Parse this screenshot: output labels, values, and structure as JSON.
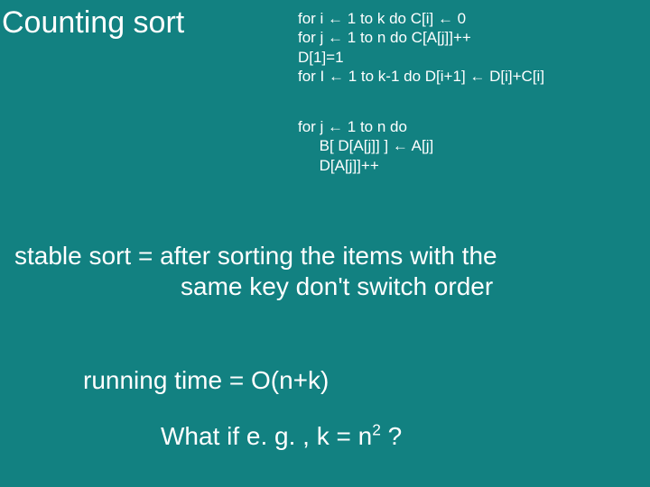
{
  "title": "Counting sort",
  "code1": "for i ← 1 to k do C[i] ← 0\nfor j ← 1 to n do C[A[j]]++\nD[1]=1\nfor I ← 1 to k-1 do D[i+1] ← D[i]+C[i]",
  "code2": "for j ← 1 to n do\n     B[ D[A[j]] ] ← A[j]\n     D[A[j]]++",
  "stable_line1": "stable sort = after sorting the items with the",
  "stable_line2": "same key don't switch order",
  "running_time": "running time = O(n+k)",
  "whatif_pre": "What if e. g. , k = n",
  "whatif_sup": "2",
  "whatif_post": " ?"
}
